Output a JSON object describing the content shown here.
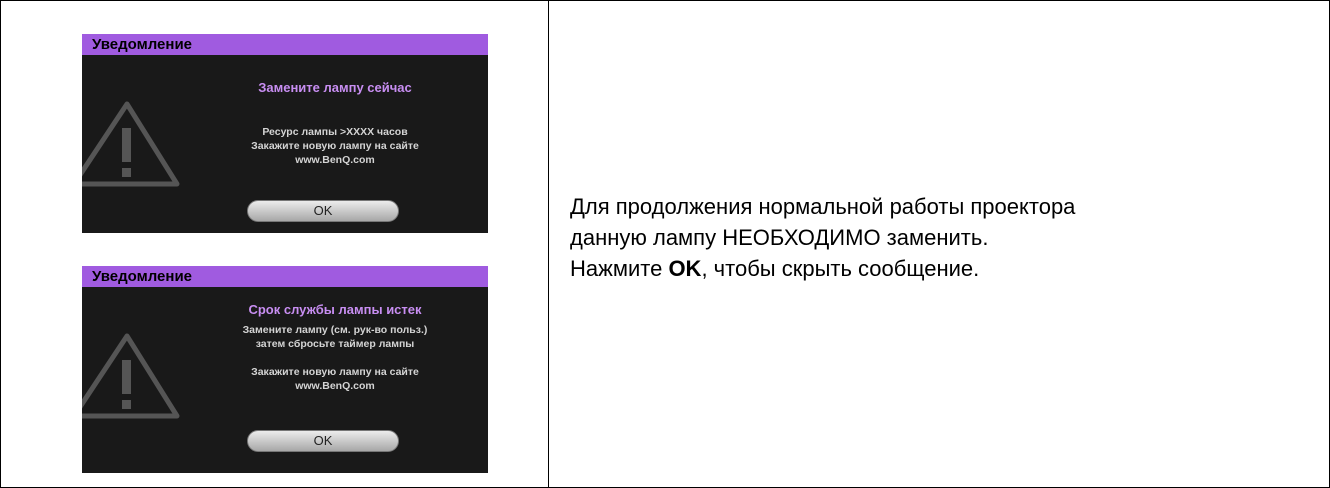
{
  "notices": [
    {
      "header": "Уведомление",
      "title": "Замените лампу сейчас",
      "lines": [
        "Ресурс лампы >XXXX часов",
        "Закажите новую лампу на сайте",
        "www.BenQ.com"
      ],
      "ok_label": "OK"
    },
    {
      "header": "Уведомление",
      "title": "Срок службы лампы истек",
      "lines": [
        "Замените лампу (см. рук-во польз.)",
        "затем сбросьте таймер лампы",
        "Закажите новую лампу на сайте",
        "www.BenQ.com"
      ],
      "ok_label": "OK"
    }
  ],
  "description": {
    "line1": "Для продолжения нормальной работы проектора",
    "line2": "данную лампу НЕОБХОДИМО заменить.",
    "line3_prefix": "Нажмите ",
    "line3_key": "OK",
    "line3_suffix": ", чтобы скрыть сообщение."
  },
  "colors": {
    "osd_header": "#a05be0",
    "osd_background": "#191919",
    "osd_title": "#c88ef2"
  }
}
